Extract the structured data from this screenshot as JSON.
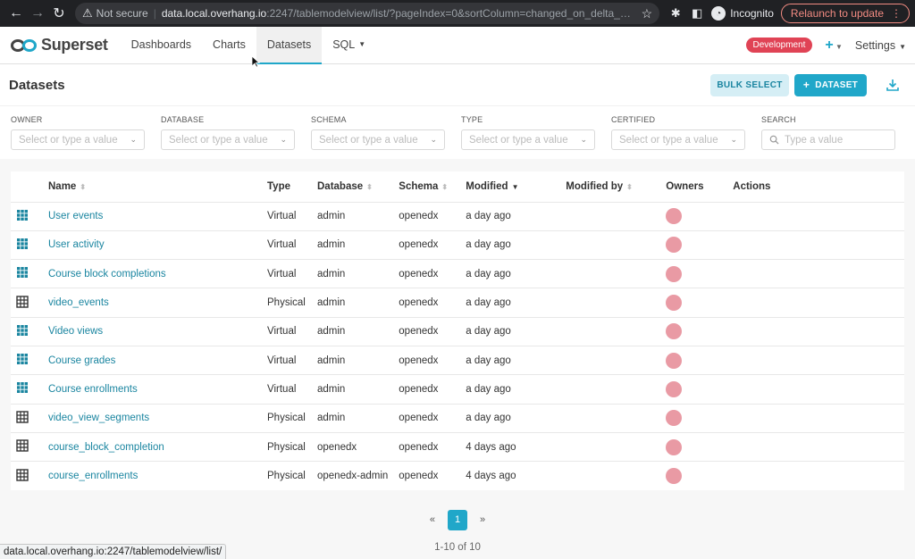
{
  "browser": {
    "not_secure": "Not secure",
    "url_host": "data.local.overhang.io",
    "url_path": ":2247/tablemodelview/list/?pageIndex=0&sortColumn=changed_on_delta_humanized&sort...",
    "incognito_label": "Incognito",
    "relaunch_label": "Relaunch to update"
  },
  "nav": {
    "brand": "Superset",
    "links": [
      {
        "label": "Dashboards"
      },
      {
        "label": "Charts"
      },
      {
        "label": "Datasets",
        "active": true
      },
      {
        "label": "SQL"
      }
    ],
    "env_badge": "Development",
    "settings_label": "Settings"
  },
  "page": {
    "title": "Datasets",
    "bulk_select_label": "BULK SELECT",
    "add_dataset_label": "DATASET"
  },
  "filters": [
    {
      "label": "OWNER",
      "placeholder": "Select or type a value"
    },
    {
      "label": "DATABASE",
      "placeholder": "Select or type a value"
    },
    {
      "label": "SCHEMA",
      "placeholder": "Select or type a value"
    },
    {
      "label": "TYPE",
      "placeholder": "Select or type a value"
    },
    {
      "label": "CERTIFIED",
      "placeholder": "Select or type a value"
    }
  ],
  "search": {
    "label": "SEARCH",
    "placeholder": "Type a value"
  },
  "table": {
    "columns": [
      "Name",
      "Type",
      "Database",
      "Schema",
      "Modified",
      "Modified by",
      "Owners",
      "Actions"
    ],
    "rows": [
      {
        "name": "User events",
        "type": "Virtual",
        "database": "admin",
        "schema": "openedx",
        "modified": "a day ago"
      },
      {
        "name": "User activity",
        "type": "Virtual",
        "database": "admin",
        "schema": "openedx",
        "modified": "a day ago"
      },
      {
        "name": "Course block completions",
        "type": "Virtual",
        "database": "admin",
        "schema": "openedx",
        "modified": "a day ago"
      },
      {
        "name": "video_events",
        "type": "Physical",
        "database": "admin",
        "schema": "openedx",
        "modified": "a day ago"
      },
      {
        "name": "Video views",
        "type": "Virtual",
        "database": "admin",
        "schema": "openedx",
        "modified": "a day ago"
      },
      {
        "name": "Course grades",
        "type": "Virtual",
        "database": "admin",
        "schema": "openedx",
        "modified": "a day ago"
      },
      {
        "name": "Course enrollments",
        "type": "Virtual",
        "database": "admin",
        "schema": "openedx",
        "modified": "a day ago"
      },
      {
        "name": "video_view_segments",
        "type": "Physical",
        "database": "admin",
        "schema": "openedx",
        "modified": "a day ago"
      },
      {
        "name": "course_block_completion",
        "type": "Physical",
        "database": "openedx",
        "schema": "openedx",
        "modified": "4 days ago"
      },
      {
        "name": "course_enrollments",
        "type": "Physical",
        "database": "openedx-admin",
        "schema": "openedx",
        "modified": "4 days ago"
      }
    ]
  },
  "pagination": {
    "prev": "«",
    "current": "1",
    "next": "»",
    "summary": "1-10 of 10"
  },
  "status_bar": {
    "url": "data.local.overhang.io:2247/tablemodelview/list/"
  },
  "colors": {
    "accent": "#20a7c9",
    "env_badge": "#e04355",
    "avatar": "#e99aa4",
    "virtual_icon": "#1a85a0",
    "physical_icon": "#333333"
  }
}
